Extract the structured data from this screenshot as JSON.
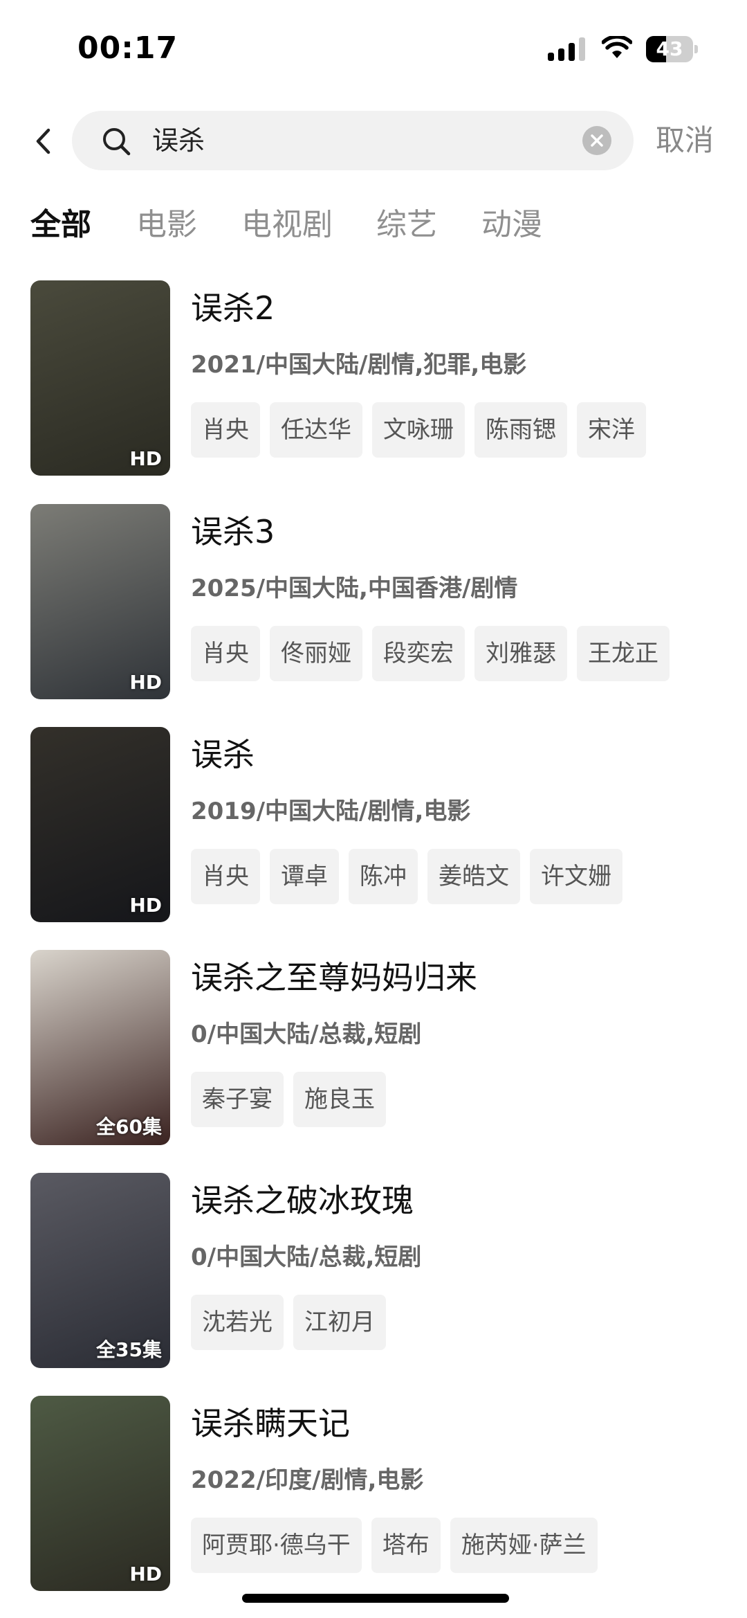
{
  "status_bar": {
    "time": "00:17",
    "battery_level": "43",
    "signal_bars_active": 3,
    "signal_bars_total": 4
  },
  "search": {
    "back_icon": "chevron-left-icon",
    "search_icon": "search-icon",
    "query": "误杀",
    "clear_icon": "clear-icon",
    "cancel_label": "取消"
  },
  "tabs": [
    {
      "label": "全部",
      "active": true
    },
    {
      "label": "电影",
      "active": false
    },
    {
      "label": "电视剧",
      "active": false
    },
    {
      "label": "综艺",
      "active": false
    },
    {
      "label": "动漫",
      "active": false
    }
  ],
  "results": [
    {
      "title": "误杀2",
      "meta": "2021/中国大陆/剧情,犯罪,电影",
      "badge": "HD",
      "cast": [
        "肖央",
        "任达华",
        "文咏珊",
        "陈雨锶",
        "宋洋"
      ],
      "poster_colors": [
        "#4a4a3c",
        "#2a2a22"
      ]
    },
    {
      "title": "误杀3",
      "meta": "2025/中国大陆,中国香港/剧情",
      "badge": "HD",
      "cast": [
        "肖央",
        "佟丽娅",
        "段奕宏",
        "刘雅瑟",
        "王龙正"
      ],
      "poster_colors": [
        "#7c7c76",
        "#2f3338"
      ]
    },
    {
      "title": "误杀",
      "meta": "2019/中国大陆/剧情,电影",
      "badge": "HD",
      "cast": [
        "肖央",
        "谭卓",
        "陈冲",
        "姜皓文",
        "许文姗"
      ],
      "poster_colors": [
        "#33302a",
        "#15161a"
      ]
    },
    {
      "title": "误杀之至尊妈妈归来",
      "meta": "0/中国大陆/总裁,短剧",
      "badge": "全60集",
      "cast": [
        "秦子宴",
        "施良玉"
      ],
      "poster_colors": [
        "#d9d4cc",
        "#3a2220"
      ]
    },
    {
      "title": "误杀之破冰玫瑰",
      "meta": "0/中国大陆/总裁,短剧",
      "badge": "全35集",
      "cast": [
        "沈若光",
        "江初月"
      ],
      "poster_colors": [
        "#5a5a62",
        "#2a2c34"
      ]
    },
    {
      "title": "误杀瞒天记",
      "meta": "2022/印度/剧情,电影",
      "badge": "HD",
      "cast": [
        "阿贾耶·德乌干",
        "塔布",
        "施芮娅·萨兰"
      ],
      "poster_colors": [
        "#4e5a44",
        "#2b2a22"
      ]
    }
  ]
}
